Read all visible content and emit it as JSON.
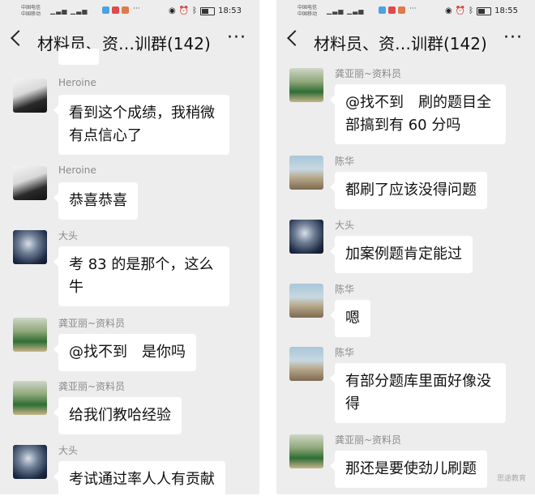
{
  "left_screen": {
    "status": {
      "carrier1": "中国电信",
      "carrier2": "中国移动",
      "time": "18:53"
    },
    "title": "材料员、资…训群(142)",
    "more": "···",
    "messages": [
      {
        "sender": "Heroine",
        "text": "看到这个成绩，我稍微有点信心了",
        "avatar": "heroine-avatar"
      },
      {
        "sender": "Heroine",
        "text": "恭喜恭喜",
        "avatar": "heroine-avatar"
      },
      {
        "sender": "大头",
        "text": "考 83 的是那个，这么牛",
        "avatar": "datou-avatar"
      },
      {
        "sender": "龚亚丽~资料员",
        "text": "@找不到　是你吗",
        "avatar": "gong-avatar"
      },
      {
        "sender": "龚亚丽~资料员",
        "text": "给我们教哈经验",
        "avatar": "gong-avatar"
      },
      {
        "sender": "大头",
        "text": "考试通过率人人有贡献",
        "avatar": "datou-avatar"
      }
    ]
  },
  "right_screen": {
    "status": {
      "carrier1": "中国电信",
      "carrier2": "中国移动",
      "time": "18:55"
    },
    "title": "材料员、资…训群(142)",
    "more": "···",
    "messages": [
      {
        "sender": "龚亚丽~资料员",
        "text": "@找不到　刷的题目全部搞到有 60 分吗",
        "avatar": "gong-avatar"
      },
      {
        "sender": "陈华",
        "text": "都刷了应该没得问题",
        "avatar": "chen-avatar"
      },
      {
        "sender": "大头",
        "text": "加案例题肯定能过",
        "avatar": "datou-avatar"
      },
      {
        "sender": "陈华",
        "text": "嗯",
        "avatar": "chen-avatar"
      },
      {
        "sender": "陈华",
        "text": "有部分题库里面好像没得",
        "avatar": "chen-avatar"
      },
      {
        "sender": "龚亚丽~资料员",
        "text": "那还是要使劲儿刷题",
        "avatar": "gong-avatar"
      }
    ],
    "watermark": "思途教育"
  }
}
